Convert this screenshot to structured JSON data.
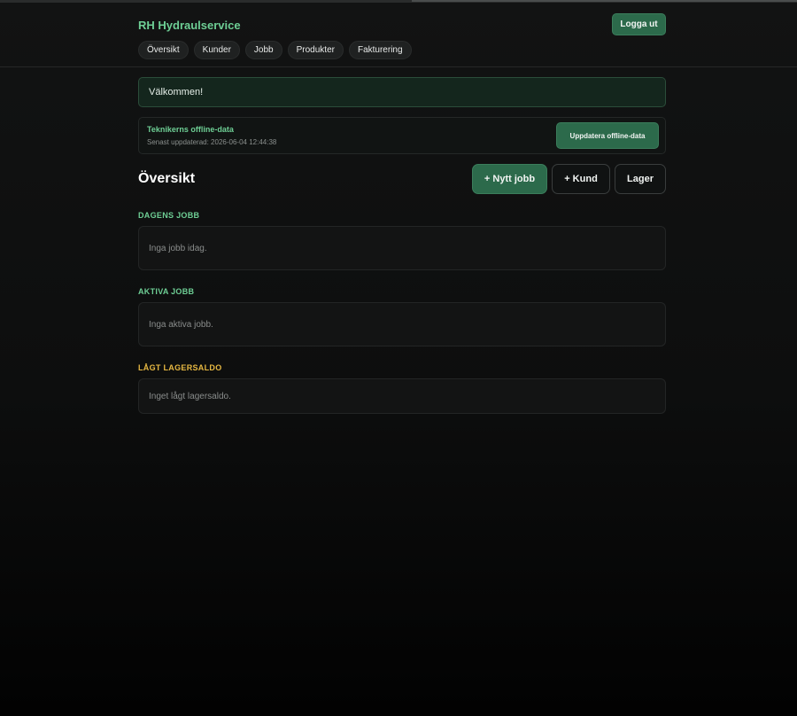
{
  "header": {
    "brand": "RH Hydraulservice",
    "logout_label": "Logga ut",
    "nav": [
      {
        "label": "Översikt"
      },
      {
        "label": "Kunder"
      },
      {
        "label": "Jobb"
      },
      {
        "label": "Produkter"
      },
      {
        "label": "Fakturering"
      }
    ]
  },
  "welcome": {
    "text": "Välkommen!"
  },
  "offline": {
    "title": "Teknikerns offline-data",
    "updated": "Senast uppdaterad: 2026-06-04 12:44:38",
    "button_label": "Uppdatera offline-data"
  },
  "overview": {
    "title": "Översikt",
    "new_job_label": "+ Nytt jobb",
    "customer_label": "+ Kund",
    "stock_label": "Lager"
  },
  "sections": {
    "todays_jobs": {
      "heading": "DAGENS JOBB",
      "empty": "Inga jobb idag."
    },
    "active_jobs": {
      "heading": "AKTIVA JOBB",
      "empty": "Inga aktiva jobb."
    },
    "low_stock": {
      "heading": "LÅGT LAGERSALDO",
      "empty": "Inget lågt lagersaldo."
    }
  },
  "colors": {
    "accent": "#2c6a4b",
    "accent_text": "#6ecf95",
    "warning_text": "#e7b842"
  }
}
